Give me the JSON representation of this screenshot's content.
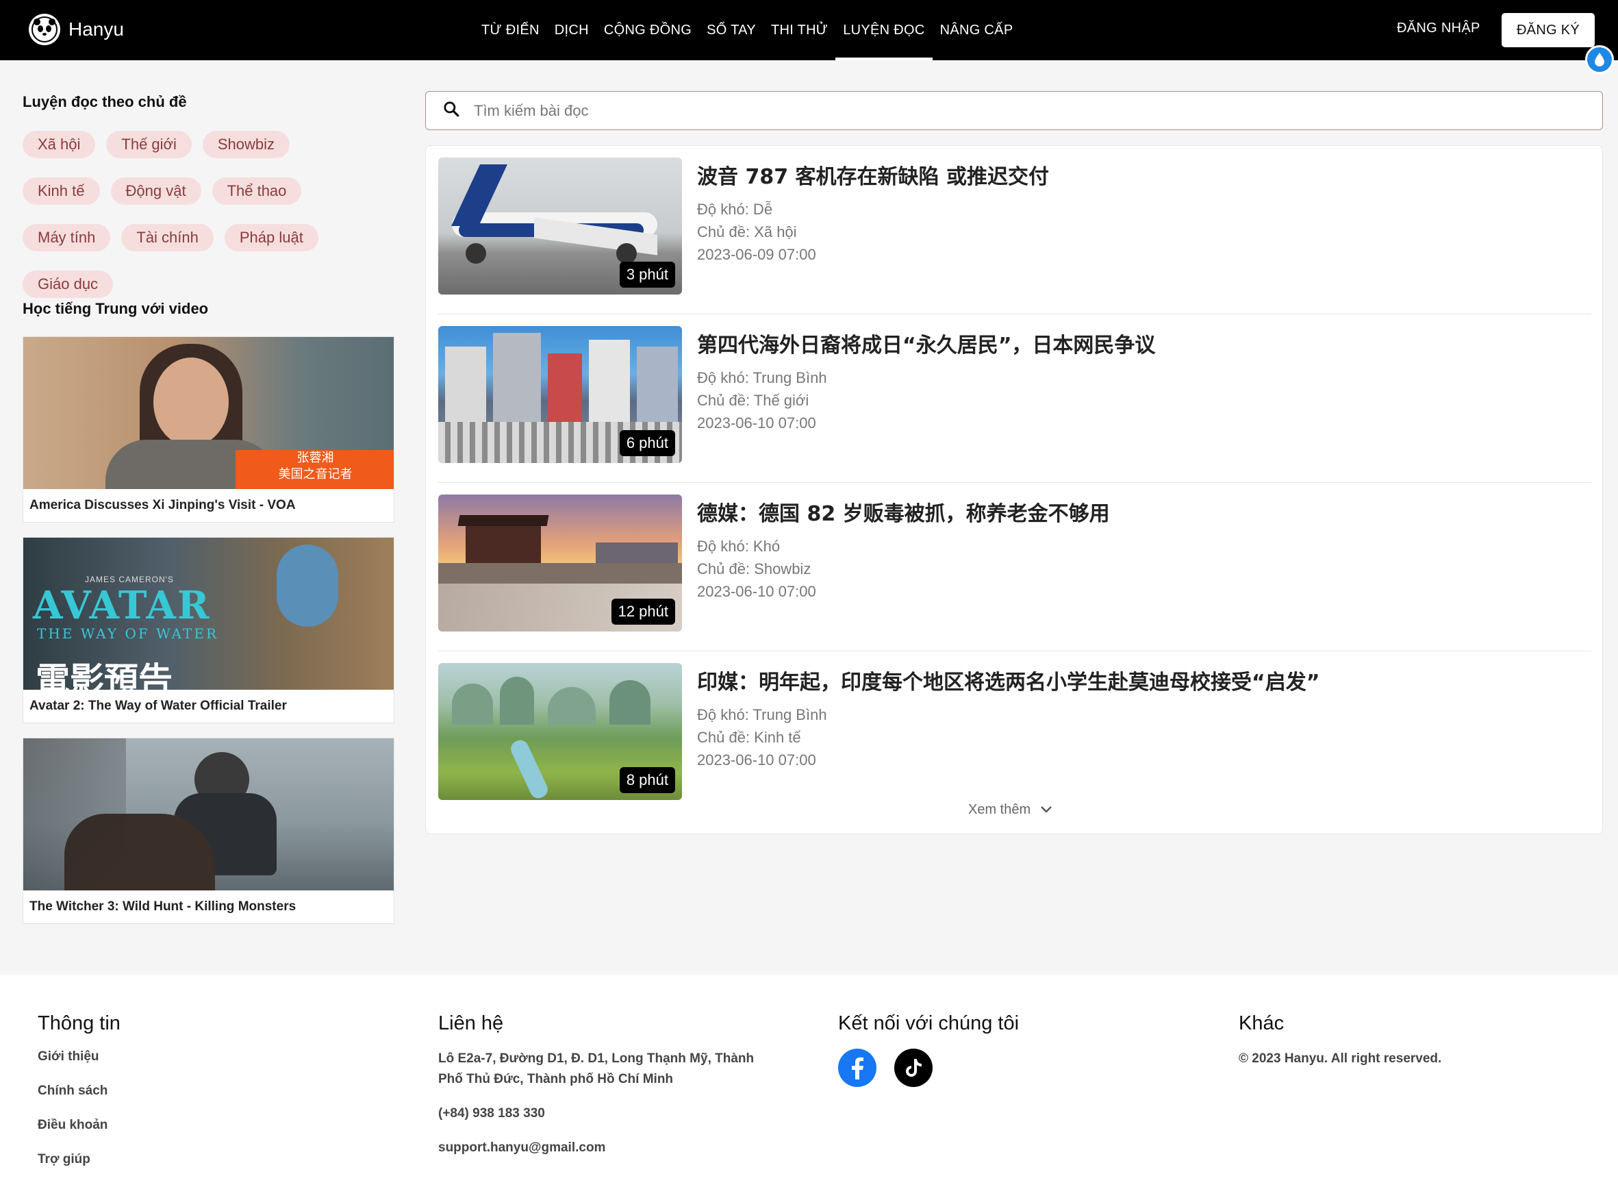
{
  "brand": {
    "name": "Hanyu"
  },
  "nav": {
    "items": [
      "TỪ ĐIỂN",
      "DỊCH",
      "CỘNG ĐỒNG",
      "SỔ TAY",
      "THI THỬ",
      "LUYỆN ĐỌC",
      "NÂNG CẤP"
    ],
    "active": "LUYỆN ĐỌC",
    "login": "ĐĂNG NHẬP",
    "signup": "ĐĂNG KÝ"
  },
  "sidebar": {
    "topics_title": "Luyện đọc theo chủ đề",
    "topics": [
      "Xã hội",
      "Thế giới",
      "Showbiz",
      "Kinh tế",
      "Động vật",
      "Thể thao",
      "Máy tính",
      "Tài chính",
      "Pháp luật",
      "Giáo dục"
    ],
    "videos_title": "Học tiếng Trung với video",
    "videos": [
      {
        "title": "America Discusses Xi Jinping's Visit - VOA",
        "overlay": "张蓉湘\n美国之音记者"
      },
      {
        "title": "Avatar 2: The Way of Water Official Trailer",
        "overlay_top": "JAMES CAMERON'S",
        "overlay_main": "AVATAR",
        "overlay_sub": "THE WAY OF WATER",
        "overlay_cn": "電影預告"
      },
      {
        "title": "The Witcher 3: Wild Hunt - Killing Monsters"
      }
    ]
  },
  "search": {
    "placeholder": "Tìm kiếm bài đọc"
  },
  "articles": [
    {
      "title": "波音 787 客机存在新缺陷 或推迟交付",
      "difficulty": "Độ khó: Dễ",
      "topic": "Chủ đề: Xã hội",
      "date": "2023-06-09 07:00",
      "duration": "3 phút",
      "thumb": "plane"
    },
    {
      "title": "第四代海外日裔将成日“永久居民”，日本网民争议",
      "difficulty": "Độ khó: Trung Bình",
      "topic": "Chủ đề: Thế giới",
      "date": "2023-06-10 07:00",
      "duration": "6 phút",
      "thumb": "city"
    },
    {
      "title": "德媒：德国 82 岁贩毒被抓，称养老金不够用",
      "difficulty": "Độ khó: Khó",
      "topic": "Chủ đề: Showbiz",
      "date": "2023-06-10 07:00",
      "duration": "12 phút",
      "thumb": "wall"
    },
    {
      "title": "印媒：明年起，印度每个地区将选两名小学生赴莫迪母校接受“启发”",
      "difficulty": "Độ khó: Trung Bình",
      "topic": "Chủ đề: Kinh tế",
      "date": "2023-06-10 07:00",
      "duration": "8 phút",
      "thumb": "landscape"
    }
  ],
  "more_label": "Xem thêm",
  "footer": {
    "info_title": "Thông tin",
    "info_links": [
      "Giới thiệu",
      "Chính sách",
      "Điều khoản",
      "Trợ giúp"
    ],
    "contact_title": "Liên hệ",
    "address": "Lô E2a-7, Đường D1, Đ. D1, Long Thạnh Mỹ, Thành Phố Thủ Đức, Thành phố Hồ Chí Minh",
    "phone": "(+84) 938 183 330",
    "email": "support.hanyu@gmail.com",
    "connect_title": "Kết nối với chúng tôi",
    "social": [
      "facebook-icon",
      "tiktok-icon"
    ],
    "other_title": "Khác",
    "copyright": "© 2023 Hanyu. All right reserved."
  },
  "colors": {
    "header_bg": "#000000",
    "tag_bg": "#f6dede",
    "tag_text": "#8a3b3b",
    "accent_blue": "#1e88e5",
    "facebook": "#1877f2"
  }
}
